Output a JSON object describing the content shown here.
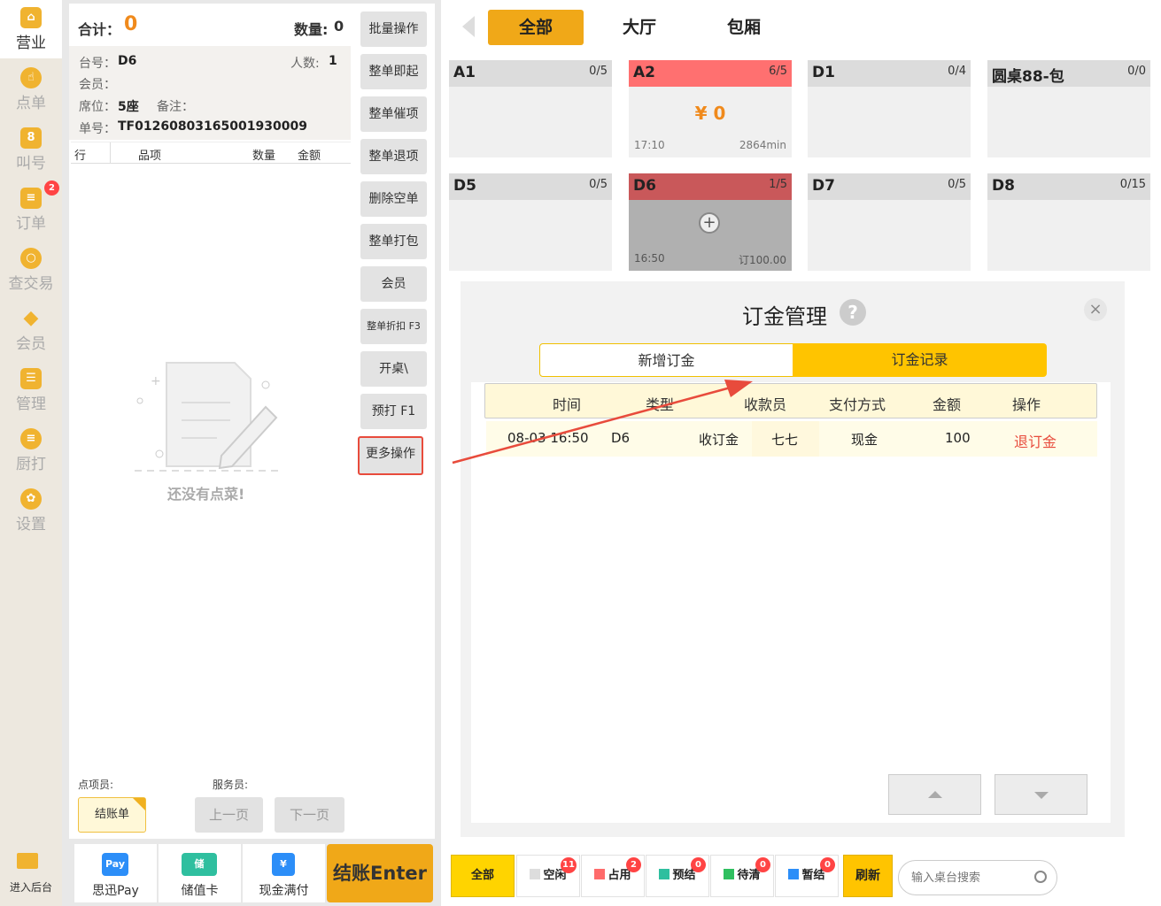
{
  "nav": {
    "items": [
      {
        "label": "营业",
        "icon": "store-icon"
      },
      {
        "label": "点单",
        "icon": "hand-pointer-icon"
      },
      {
        "label": "叫号",
        "icon": "number-8-icon"
      },
      {
        "label": "订单",
        "icon": "list-icon",
        "badge": "2"
      },
      {
        "label": "查交易",
        "icon": "search-icon"
      },
      {
        "label": "会员",
        "icon": "diamond-icon"
      },
      {
        "label": "管理",
        "icon": "checklist-icon"
      },
      {
        "label": "厨打",
        "icon": "menu-icon"
      },
      {
        "label": "设置",
        "icon": "gear-icon"
      }
    ],
    "backend": "进入后台"
  },
  "order": {
    "total_label": "合计：",
    "total_value": "0",
    "qty_label": "数量:",
    "qty_value": "0",
    "table_label": "台号：",
    "table_value": "D6",
    "people_label": "人数:",
    "people_value": "1",
    "member_label": "会员：",
    "seat_label": "席位：",
    "seat_value": "5座",
    "note_label": "备注：",
    "no_label": "单号：",
    "no_value": "TF0126080316500193​0009",
    "col_row": "行",
    "col_item": "品项",
    "col_qty": "数量",
    "col_amount": "金额",
    "empty_text": "还没有点菜!",
    "orderer_label": "点项员:",
    "waiter_label": "服务员:",
    "checkout_bill": "结账单",
    "prev_page": "上一页",
    "next_page": "下一页"
  },
  "actions": [
    "批量操作",
    "整单即起",
    "整单催项",
    "整单退项",
    "删除空单",
    "整单打包",
    "会员",
    "整单折扣 F3",
    "开桌\\",
    "预打 F1",
    "更多操作"
  ],
  "pay": {
    "sixun_icon": "Pay",
    "sixun": "思迅Pay",
    "card": "储值卡",
    "card_icon": "储",
    "cash": "现金满付",
    "cash_icon": "¥",
    "checkout": "结账Enter"
  },
  "area_tabs": [
    "全部",
    "大厅",
    "包厢"
  ],
  "tables": [
    {
      "name": "A1",
      "count": "0/5"
    },
    {
      "name": "A2",
      "count": "6/5",
      "amount": "¥ 0",
      "time": "17:10",
      "duration": "2864min"
    },
    {
      "name": "D1",
      "count": "0/4"
    },
    {
      "name": "圆桌88-包",
      "count": "0/0"
    },
    {
      "name": "D5",
      "count": "0/5"
    },
    {
      "name": "D6",
      "count": "1/5",
      "time": "16:50",
      "deposit": "订100.00"
    },
    {
      "name": "D7",
      "count": "0/5"
    },
    {
      "name": "D8",
      "count": "0/15"
    }
  ],
  "modal": {
    "title": "订金管理",
    "help": "?",
    "close": "×",
    "tab_new": "新增订金",
    "tab_records": "订金记录",
    "headers": [
      "时间",
      "类型",
      "收款员",
      "支付方式",
      "金额",
      "操作"
    ],
    "row": {
      "time": "08-03 16:50",
      "table": "D6",
      "type": "收订金",
      "cashier": "七七",
      "method": "现金",
      "amount": "100",
      "action": "退订金"
    }
  },
  "status": {
    "all": "全部",
    "idle": "空闲",
    "idle_count": "11",
    "occupied": "占用",
    "occupied_count": "2",
    "prepay": "预结",
    "prepay_count": "0",
    "to_clean": "待清",
    "to_clean_count": "0",
    "pause": "暂结",
    "pause_count": "0",
    "refresh": "刷新",
    "search_placeholder": "输入桌台搜索"
  },
  "colors": {
    "accent": "#f0b020",
    "occupied": "#ff6b6b",
    "reserved": "#c9585a",
    "danger": "#e84b3c"
  }
}
